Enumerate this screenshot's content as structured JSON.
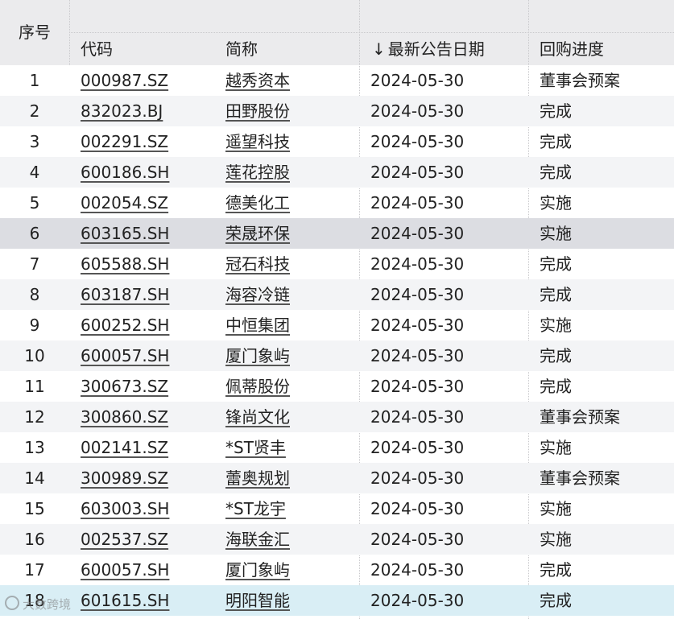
{
  "header": {
    "seq": "序号",
    "code": "代码",
    "name": "简称",
    "date": "最新公告日期",
    "sort_arrow": "↓",
    "progress": "回购进度"
  },
  "rows": [
    {
      "seq": "1",
      "code": "000987.SZ",
      "name": "越秀资本",
      "date": "2024-05-30",
      "progress": "董事会预案"
    },
    {
      "seq": "2",
      "code": "832023.BJ",
      "name": "田野股份",
      "date": "2024-05-30",
      "progress": "完成"
    },
    {
      "seq": "3",
      "code": "002291.SZ",
      "name": "遥望科技",
      "date": "2024-05-30",
      "progress": "完成"
    },
    {
      "seq": "4",
      "code": "600186.SH",
      "name": "莲花控股",
      "date": "2024-05-30",
      "progress": "完成"
    },
    {
      "seq": "5",
      "code": "002054.SZ",
      "name": "德美化工",
      "date": "2024-05-30",
      "progress": "实施"
    },
    {
      "seq": "6",
      "code": "603165.SH",
      "name": "荣晟环保",
      "date": "2024-05-30",
      "progress": "实施"
    },
    {
      "seq": "7",
      "code": "605588.SH",
      "name": "冠石科技",
      "date": "2024-05-30",
      "progress": "完成"
    },
    {
      "seq": "8",
      "code": "603187.SH",
      "name": "海容冷链",
      "date": "2024-05-30",
      "progress": "完成"
    },
    {
      "seq": "9",
      "code": "600252.SH",
      "name": "中恒集团",
      "date": "2024-05-30",
      "progress": "实施"
    },
    {
      "seq": "10",
      "code": "600057.SH",
      "name": "厦门象屿",
      "date": "2024-05-30",
      "progress": "完成"
    },
    {
      "seq": "11",
      "code": "300673.SZ",
      "name": "佩蒂股份",
      "date": "2024-05-30",
      "progress": "完成"
    },
    {
      "seq": "12",
      "code": "300860.SZ",
      "name": "锋尚文化",
      "date": "2024-05-30",
      "progress": "董事会预案"
    },
    {
      "seq": "13",
      "code": "002141.SZ",
      "name": "*ST贤丰",
      "date": "2024-05-30",
      "progress": "实施"
    },
    {
      "seq": "14",
      "code": "300989.SZ",
      "name": "蕾奥规划",
      "date": "2024-05-30",
      "progress": "董事会预案"
    },
    {
      "seq": "15",
      "code": "603003.SH",
      "name": "*ST龙宇",
      "date": "2024-05-30",
      "progress": "实施"
    },
    {
      "seq": "16",
      "code": "002537.SZ",
      "name": "海联金汇",
      "date": "2024-05-30",
      "progress": "实施"
    },
    {
      "seq": "17",
      "code": "600057.SH",
      "name": "厦门象屿",
      "date": "2024-05-30",
      "progress": "完成"
    },
    {
      "seq": "18",
      "code": "601615.SH",
      "name": "明阳智能",
      "date": "2024-05-30",
      "progress": "完成"
    }
  ],
  "watermark": "大数跨境"
}
